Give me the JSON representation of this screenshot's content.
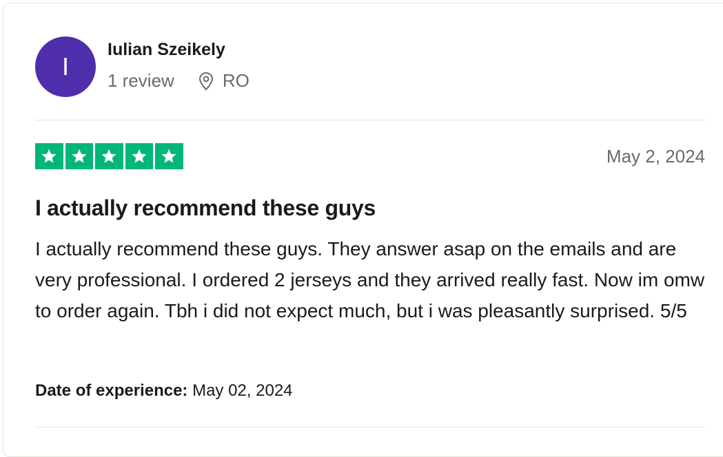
{
  "reviewer": {
    "initial": "I",
    "name": "Iulian Szeikely",
    "review_count": "1 review",
    "location": "RO",
    "location_icon": "location-pin-icon",
    "avatar_color": "#4f2eac"
  },
  "rating": {
    "stars": 5,
    "max_stars": 5,
    "star_color": "#00b67a",
    "star_fill_color": "#ffffff",
    "star_icon": "star-icon"
  },
  "review": {
    "date": "May 2, 2024",
    "title": "I actually recommend these guys",
    "body": "I actually recommend these guys. They answer asap on the emails and are very professional. I ordered 2 jerseys and they arrived really fast. Now im omw to order again. Tbh i did not expect much, but i was pleasantly surprised. 5/5",
    "experience_label": "Date of experience:",
    "experience_date": "May 02, 2024"
  }
}
